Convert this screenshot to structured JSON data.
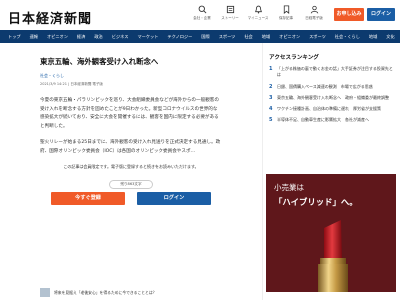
{
  "header": {
    "logo": "日本経済新聞",
    "icons": [
      {
        "name": "keyword-icon",
        "label": "会社・企業"
      },
      {
        "name": "news-list-icon",
        "label": "ストーリー"
      },
      {
        "name": "bell-icon",
        "label": "マイニュース"
      },
      {
        "name": "bookmark-icon",
        "label": "保存記事"
      },
      {
        "name": "user-icon",
        "label": "日経電子版"
      }
    ],
    "subscribe_label": "お申し込み",
    "login_label": "ログイン"
  },
  "nav": [
    "トップ",
    "速報",
    "オピニオン",
    "経済",
    "政治",
    "ビジネス",
    "マーケット",
    "テクノロジー",
    "国際",
    "スポーツ",
    "社会",
    "地域",
    "オピニオン",
    "スポーツ",
    "社会・くらし",
    "地域",
    "文化",
    "ライフ"
  ],
  "article": {
    "title": "東京五輪、海外観客受け入れ断念へ",
    "category": "社会・くらし",
    "meta": "2021/3/9 14:21 | 日本経済新聞 電子版",
    "para1": "今夏の東京五輪・パラリンピックを巡り、大会組織委員会などが海外からの一般観客の受け入れを断念する方針を固めたことが9日わかった。新型コロナウイルスの世界的な感染拡大が続いており、安全に大会を開催するには、観客を国内に限定する必要があると判断した。",
    "para2": "聖火リレーが始まる25日までに、海外観客の受け入れ見送りを正式決定する見通し。政府、国際オリンピック委員会（IOC）は各国のオリンピック委員会やスポ…",
    "paywall_msg": "この記事は会員限定です。電子版に登録すると続きをお読みいただけます。",
    "paywall_pill": "残り863文字",
    "btn_trial": "今すぐ登録",
    "btn_login": "ログイン"
  },
  "bottom_banner": "将来を見据え「老後安心」を得るために今できることとは？",
  "sidebar": {
    "title": "アクセスランキング",
    "items": [
      {
        "num": "1",
        "text": "「上がる株価の裏で動くお金の話」大手証券が注目する投資先とは"
      },
      {
        "num": "2",
        "text": "日銀、国債購入ペース減速の観測　市場で広がる思惑"
      },
      {
        "num": "3",
        "text": "東京五輪、海外観客受け入れ断念へ　政府・組織委が最終調整"
      },
      {
        "num": "4",
        "text": "ワクチン接種計画、自治体の準備に遅れ　厚労省が支援策"
      },
      {
        "num": "5",
        "text": "半導体不足、自動車生産に影響拡大　各社が減産へ"
      }
    ]
  },
  "ad": {
    "sub": "小売業は",
    "headline": "「ハイブリッド」へ。"
  }
}
